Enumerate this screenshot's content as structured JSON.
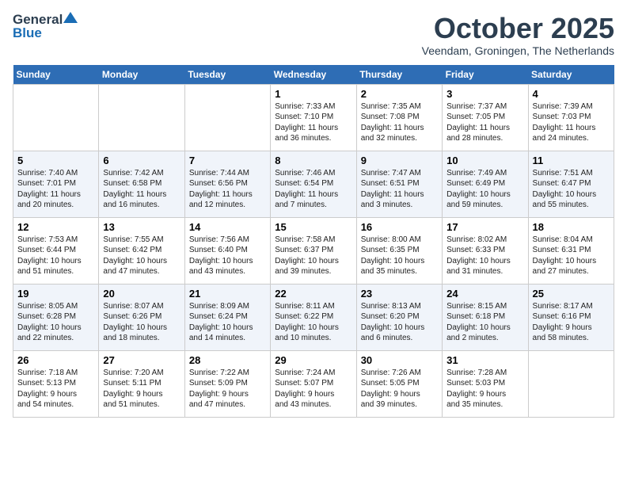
{
  "header": {
    "logo_general": "General",
    "logo_blue": "Blue",
    "month_title": "October 2025",
    "subtitle": "Veendam, Groningen, The Netherlands"
  },
  "days_of_week": [
    "Sunday",
    "Monday",
    "Tuesday",
    "Wednesday",
    "Thursday",
    "Friday",
    "Saturday"
  ],
  "weeks": [
    [
      {
        "day": "",
        "content": ""
      },
      {
        "day": "",
        "content": ""
      },
      {
        "day": "",
        "content": ""
      },
      {
        "day": "1",
        "content": "Sunrise: 7:33 AM\nSunset: 7:10 PM\nDaylight: 11 hours\nand 36 minutes."
      },
      {
        "day": "2",
        "content": "Sunrise: 7:35 AM\nSunset: 7:08 PM\nDaylight: 11 hours\nand 32 minutes."
      },
      {
        "day": "3",
        "content": "Sunrise: 7:37 AM\nSunset: 7:05 PM\nDaylight: 11 hours\nand 28 minutes."
      },
      {
        "day": "4",
        "content": "Sunrise: 7:39 AM\nSunset: 7:03 PM\nDaylight: 11 hours\nand 24 minutes."
      }
    ],
    [
      {
        "day": "5",
        "content": "Sunrise: 7:40 AM\nSunset: 7:01 PM\nDaylight: 11 hours\nand 20 minutes."
      },
      {
        "day": "6",
        "content": "Sunrise: 7:42 AM\nSunset: 6:58 PM\nDaylight: 11 hours\nand 16 minutes."
      },
      {
        "day": "7",
        "content": "Sunrise: 7:44 AM\nSunset: 6:56 PM\nDaylight: 11 hours\nand 12 minutes."
      },
      {
        "day": "8",
        "content": "Sunrise: 7:46 AM\nSunset: 6:54 PM\nDaylight: 11 hours\nand 7 minutes."
      },
      {
        "day": "9",
        "content": "Sunrise: 7:47 AM\nSunset: 6:51 PM\nDaylight: 11 hours\nand 3 minutes."
      },
      {
        "day": "10",
        "content": "Sunrise: 7:49 AM\nSunset: 6:49 PM\nDaylight: 10 hours\nand 59 minutes."
      },
      {
        "day": "11",
        "content": "Sunrise: 7:51 AM\nSunset: 6:47 PM\nDaylight: 10 hours\nand 55 minutes."
      }
    ],
    [
      {
        "day": "12",
        "content": "Sunrise: 7:53 AM\nSunset: 6:44 PM\nDaylight: 10 hours\nand 51 minutes."
      },
      {
        "day": "13",
        "content": "Sunrise: 7:55 AM\nSunset: 6:42 PM\nDaylight: 10 hours\nand 47 minutes."
      },
      {
        "day": "14",
        "content": "Sunrise: 7:56 AM\nSunset: 6:40 PM\nDaylight: 10 hours\nand 43 minutes."
      },
      {
        "day": "15",
        "content": "Sunrise: 7:58 AM\nSunset: 6:37 PM\nDaylight: 10 hours\nand 39 minutes."
      },
      {
        "day": "16",
        "content": "Sunrise: 8:00 AM\nSunset: 6:35 PM\nDaylight: 10 hours\nand 35 minutes."
      },
      {
        "day": "17",
        "content": "Sunrise: 8:02 AM\nSunset: 6:33 PM\nDaylight: 10 hours\nand 31 minutes."
      },
      {
        "day": "18",
        "content": "Sunrise: 8:04 AM\nSunset: 6:31 PM\nDaylight: 10 hours\nand 27 minutes."
      }
    ],
    [
      {
        "day": "19",
        "content": "Sunrise: 8:05 AM\nSunset: 6:28 PM\nDaylight: 10 hours\nand 22 minutes."
      },
      {
        "day": "20",
        "content": "Sunrise: 8:07 AM\nSunset: 6:26 PM\nDaylight: 10 hours\nand 18 minutes."
      },
      {
        "day": "21",
        "content": "Sunrise: 8:09 AM\nSunset: 6:24 PM\nDaylight: 10 hours\nand 14 minutes."
      },
      {
        "day": "22",
        "content": "Sunrise: 8:11 AM\nSunset: 6:22 PM\nDaylight: 10 hours\nand 10 minutes."
      },
      {
        "day": "23",
        "content": "Sunrise: 8:13 AM\nSunset: 6:20 PM\nDaylight: 10 hours\nand 6 minutes."
      },
      {
        "day": "24",
        "content": "Sunrise: 8:15 AM\nSunset: 6:18 PM\nDaylight: 10 hours\nand 2 minutes."
      },
      {
        "day": "25",
        "content": "Sunrise: 8:17 AM\nSunset: 6:16 PM\nDaylight: 9 hours\nand 58 minutes."
      }
    ],
    [
      {
        "day": "26",
        "content": "Sunrise: 7:18 AM\nSunset: 5:13 PM\nDaylight: 9 hours\nand 54 minutes."
      },
      {
        "day": "27",
        "content": "Sunrise: 7:20 AM\nSunset: 5:11 PM\nDaylight: 9 hours\nand 51 minutes."
      },
      {
        "day": "28",
        "content": "Sunrise: 7:22 AM\nSunset: 5:09 PM\nDaylight: 9 hours\nand 47 minutes."
      },
      {
        "day": "29",
        "content": "Sunrise: 7:24 AM\nSunset: 5:07 PM\nDaylight: 9 hours\nand 43 minutes."
      },
      {
        "day": "30",
        "content": "Sunrise: 7:26 AM\nSunset: 5:05 PM\nDaylight: 9 hours\nand 39 minutes."
      },
      {
        "day": "31",
        "content": "Sunrise: 7:28 AM\nSunset: 5:03 PM\nDaylight: 9 hours\nand 35 minutes."
      },
      {
        "day": "",
        "content": ""
      }
    ]
  ]
}
